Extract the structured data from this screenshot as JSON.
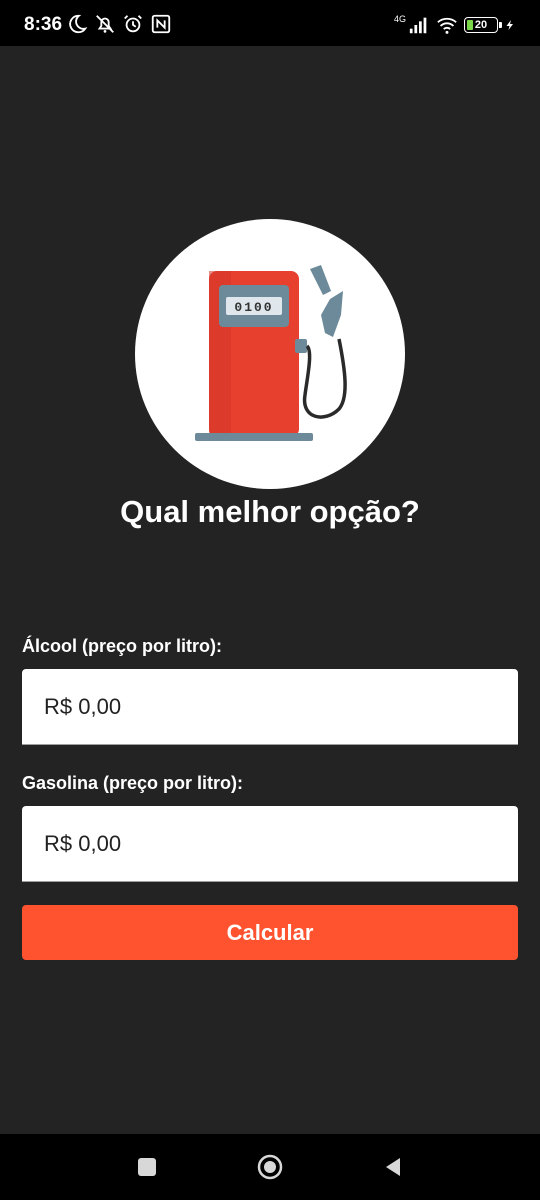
{
  "status_bar": {
    "time": "8:36",
    "network_type": "4G",
    "battery_level": "20",
    "left_icons": [
      "moon-icon",
      "notifications-off-icon",
      "alarm-icon",
      "nfc-icon"
    ],
    "right_icons": [
      "signal-icon",
      "wifi-icon",
      "battery-icon",
      "charging-icon"
    ]
  },
  "hero": {
    "icon": "fuel-pump-icon",
    "pump_display": "0100",
    "title": "Qual melhor opção?"
  },
  "form": {
    "alcool_label": "Álcool (preço por litro):",
    "alcool_placeholder": "R$ 0,00",
    "gasolina_label": "Gasolina (preço por litro):",
    "gasolina_placeholder": "R$ 0,00",
    "calculate_label": "Calcular"
  },
  "nav_bar": {
    "buttons": [
      "recents-icon",
      "home-icon",
      "back-icon"
    ]
  },
  "colors": {
    "background": "#232323",
    "accent": "#ff5330",
    "pump_red": "#e8402e",
    "pump_gray": "#6c8a99"
  }
}
